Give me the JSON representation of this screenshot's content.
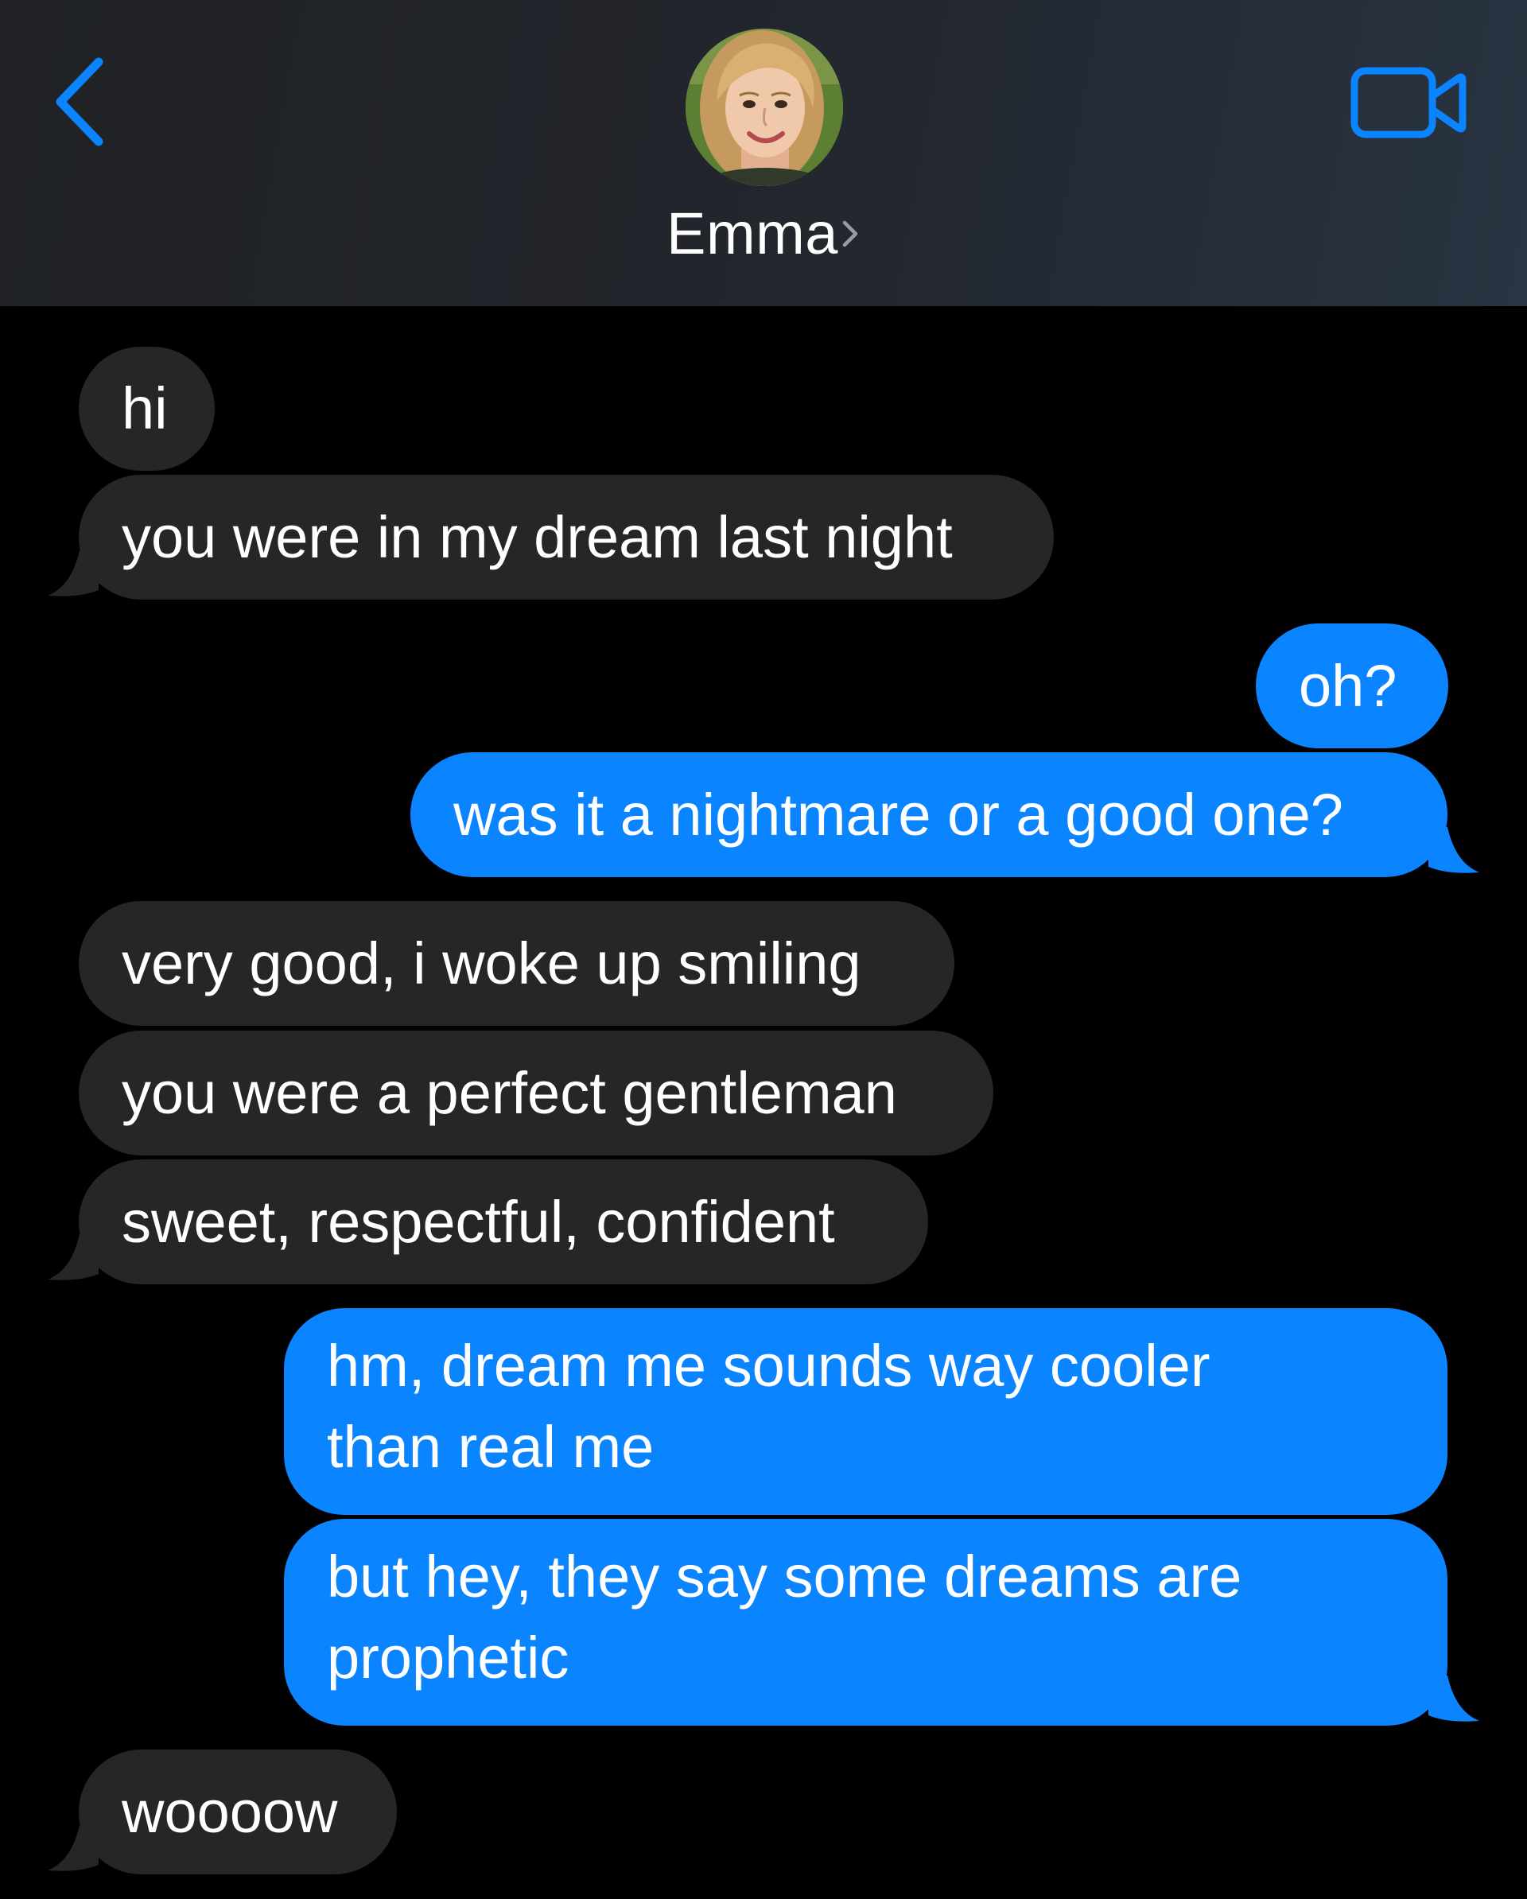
{
  "header": {
    "contact_name": "Emma",
    "back_icon": "chevron-left-icon",
    "video_icon": "video-camera-icon",
    "accent_color": "#0a84ff"
  },
  "colors": {
    "received_bubble": "#262629",
    "sent_bubble": "#0a84ff",
    "background": "#000000",
    "text": "#ffffff"
  },
  "messages": [
    {
      "sender": "them",
      "lines": [
        "hi"
      ]
    },
    {
      "sender": "them",
      "lines": [
        "you were in my dream last night"
      ]
    },
    {
      "sender": "me",
      "lines": [
        "oh?"
      ]
    },
    {
      "sender": "me",
      "lines": [
        "was it a nightmare or a good one?"
      ]
    },
    {
      "sender": "them",
      "lines": [
        "very good, i woke up smiling"
      ]
    },
    {
      "sender": "them",
      "lines": [
        "you were a perfect gentleman"
      ]
    },
    {
      "sender": "them",
      "lines": [
        "sweet, respectful, confident"
      ]
    },
    {
      "sender": "me",
      "lines": [
        "hm, dream me sounds way cooler",
        "than real me"
      ]
    },
    {
      "sender": "me",
      "lines": [
        "but hey, they say some dreams are",
        "prophetic"
      ]
    },
    {
      "sender": "them",
      "lines": [
        "woooow"
      ]
    }
  ]
}
